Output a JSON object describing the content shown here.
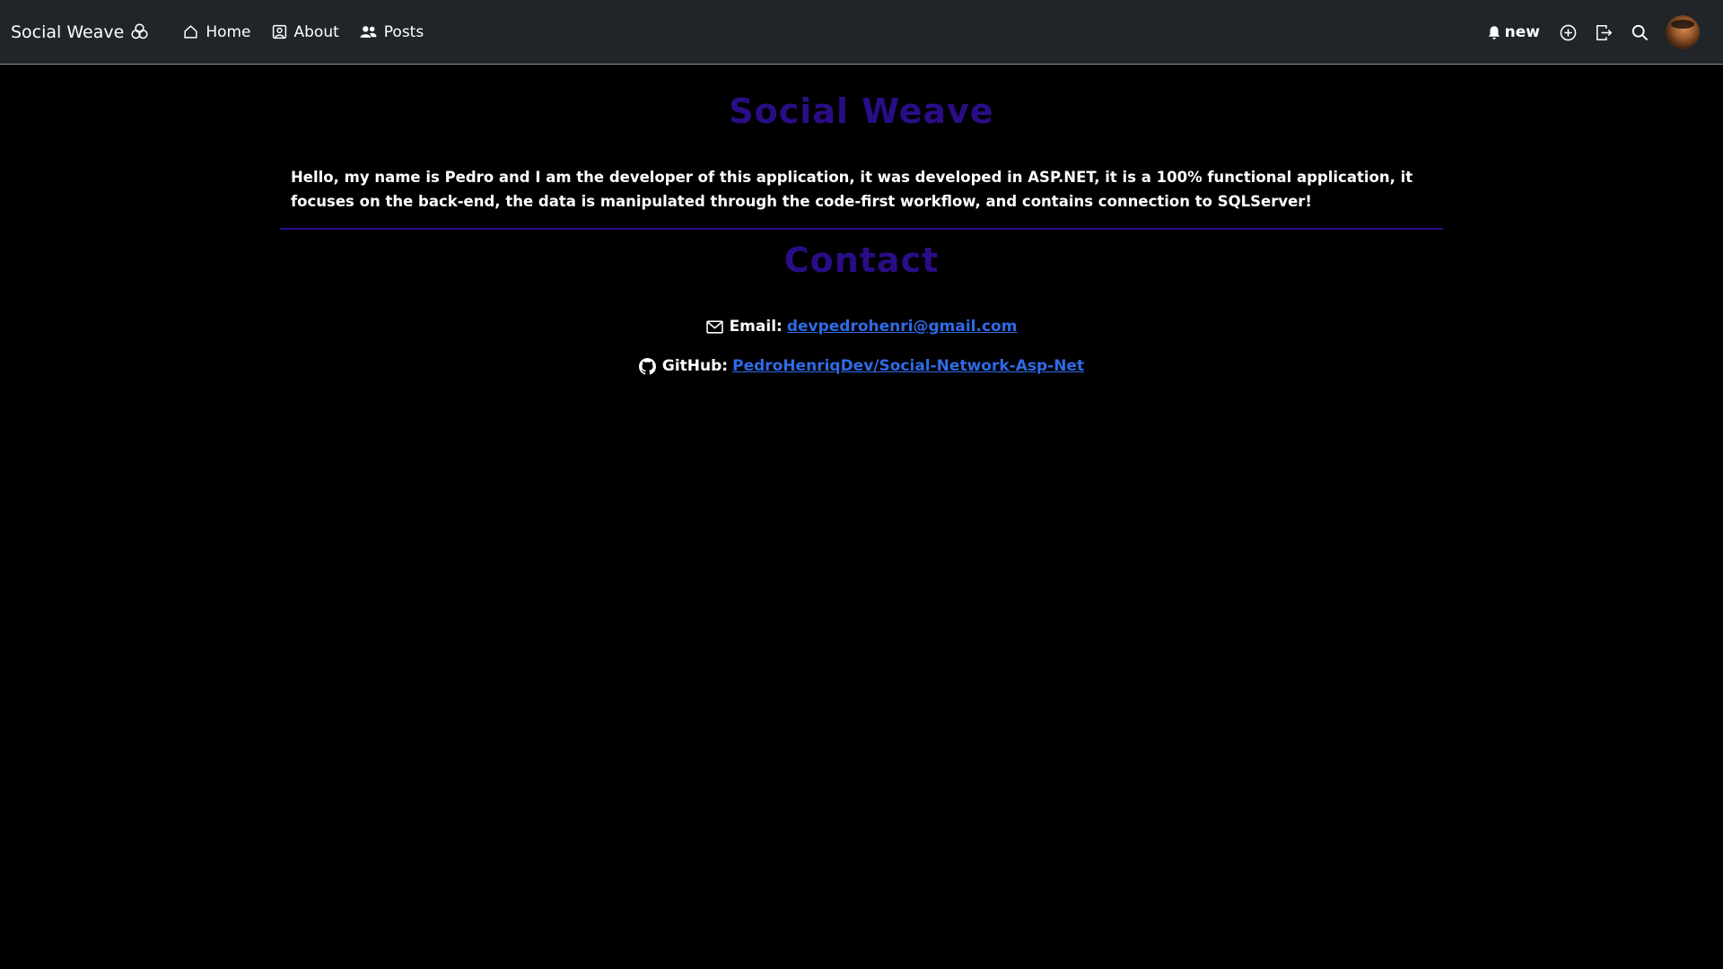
{
  "navbar": {
    "brand": "Social Weave",
    "links": [
      {
        "label": "Home",
        "icon": "house-icon"
      },
      {
        "label": "About",
        "icon": "person-badge-icon"
      },
      {
        "label": "Posts",
        "icon": "people-icon"
      }
    ],
    "notification_label": "new",
    "right_icons": [
      "bell-icon",
      "plus-circle-icon",
      "logout-icon",
      "search-icon",
      "avatar"
    ]
  },
  "about": {
    "title": "Social Weave",
    "intro": "Hello, my name is Pedro and I am the developer of this application, it was developed in ASP.NET, it is a 100% functional application, it focuses on the back-end, the data is manipulated through the code-first workflow, and contains connection to SQLServer!"
  },
  "contact": {
    "title": "Contact",
    "email_label": "Email:",
    "email_value": "devpedrohenri@gmail.com",
    "github_label": "GitHub:",
    "github_value": "PedroHenriqDev/Social-Network-Asp-Net"
  },
  "colors": {
    "background": "#000000",
    "navbar": "#212529",
    "heading": "#2a0d86",
    "divider": "#2d0d8f",
    "link": "#2e6be6"
  }
}
